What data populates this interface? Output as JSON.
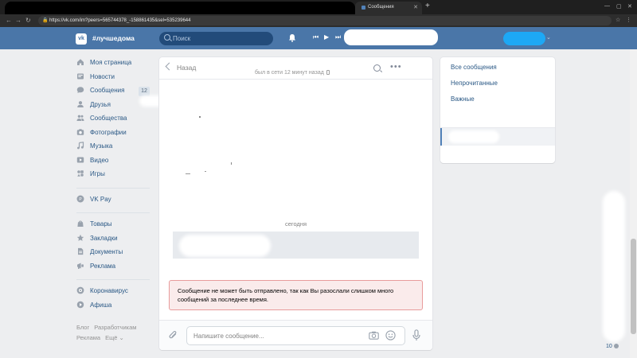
{
  "browser": {
    "tab_title": "Сообщения",
    "url": "https://vk.com/im?peers=565744378_-158861435&sel=535239644"
  },
  "header": {
    "brand": "#лучшедома",
    "search_placeholder": "Поиск",
    "accent_color": "#4a76a8"
  },
  "leftnav": {
    "items": [
      {
        "label": "Моя страница",
        "icon": "home-icon"
      },
      {
        "label": "Новости",
        "icon": "news-icon"
      },
      {
        "label": "Сообщения",
        "icon": "messages-icon",
        "badge": "12"
      },
      {
        "label": "Друзья",
        "icon": "friends-icon"
      },
      {
        "label": "Сообщества",
        "icon": "groups-icon"
      },
      {
        "label": "Фотографии",
        "icon": "photo-icon"
      },
      {
        "label": "Музыка",
        "icon": "music-icon"
      },
      {
        "label": "Видео",
        "icon": "video-icon"
      },
      {
        "label": "Игры",
        "icon": "games-icon"
      }
    ],
    "pay": {
      "label": "VK Pay",
      "icon": "vkpay-icon"
    },
    "group3": [
      {
        "label": "Товары",
        "icon": "goods-icon"
      },
      {
        "label": "Закладки",
        "icon": "bookmarks-icon"
      },
      {
        "label": "Документы",
        "icon": "documents-icon"
      },
      {
        "label": "Реклама",
        "icon": "ads-icon"
      }
    ],
    "group4": [
      {
        "label": "Коронавирус",
        "icon": "coronavirus-icon"
      },
      {
        "label": "Афиша",
        "icon": "events-icon"
      }
    ],
    "footer": {
      "blog": "Блог",
      "developers": "Разработчикам",
      "ads": "Реклама",
      "more": "Ещё ⌄"
    }
  },
  "chat": {
    "back_label": "Назад",
    "last_seen": "был в сети 12 минут назад",
    "date_label": "сегодня",
    "error_text": "Сообщение не может быть отправлено, так как Вы разослали слишком много сообщений за последнее время.",
    "compose_placeholder": "Напишите сообщение..."
  },
  "filter": {
    "all": "Все сообщения",
    "unread": "Непрочитанные",
    "important": "Важные"
  },
  "corner": {
    "count": "10"
  }
}
